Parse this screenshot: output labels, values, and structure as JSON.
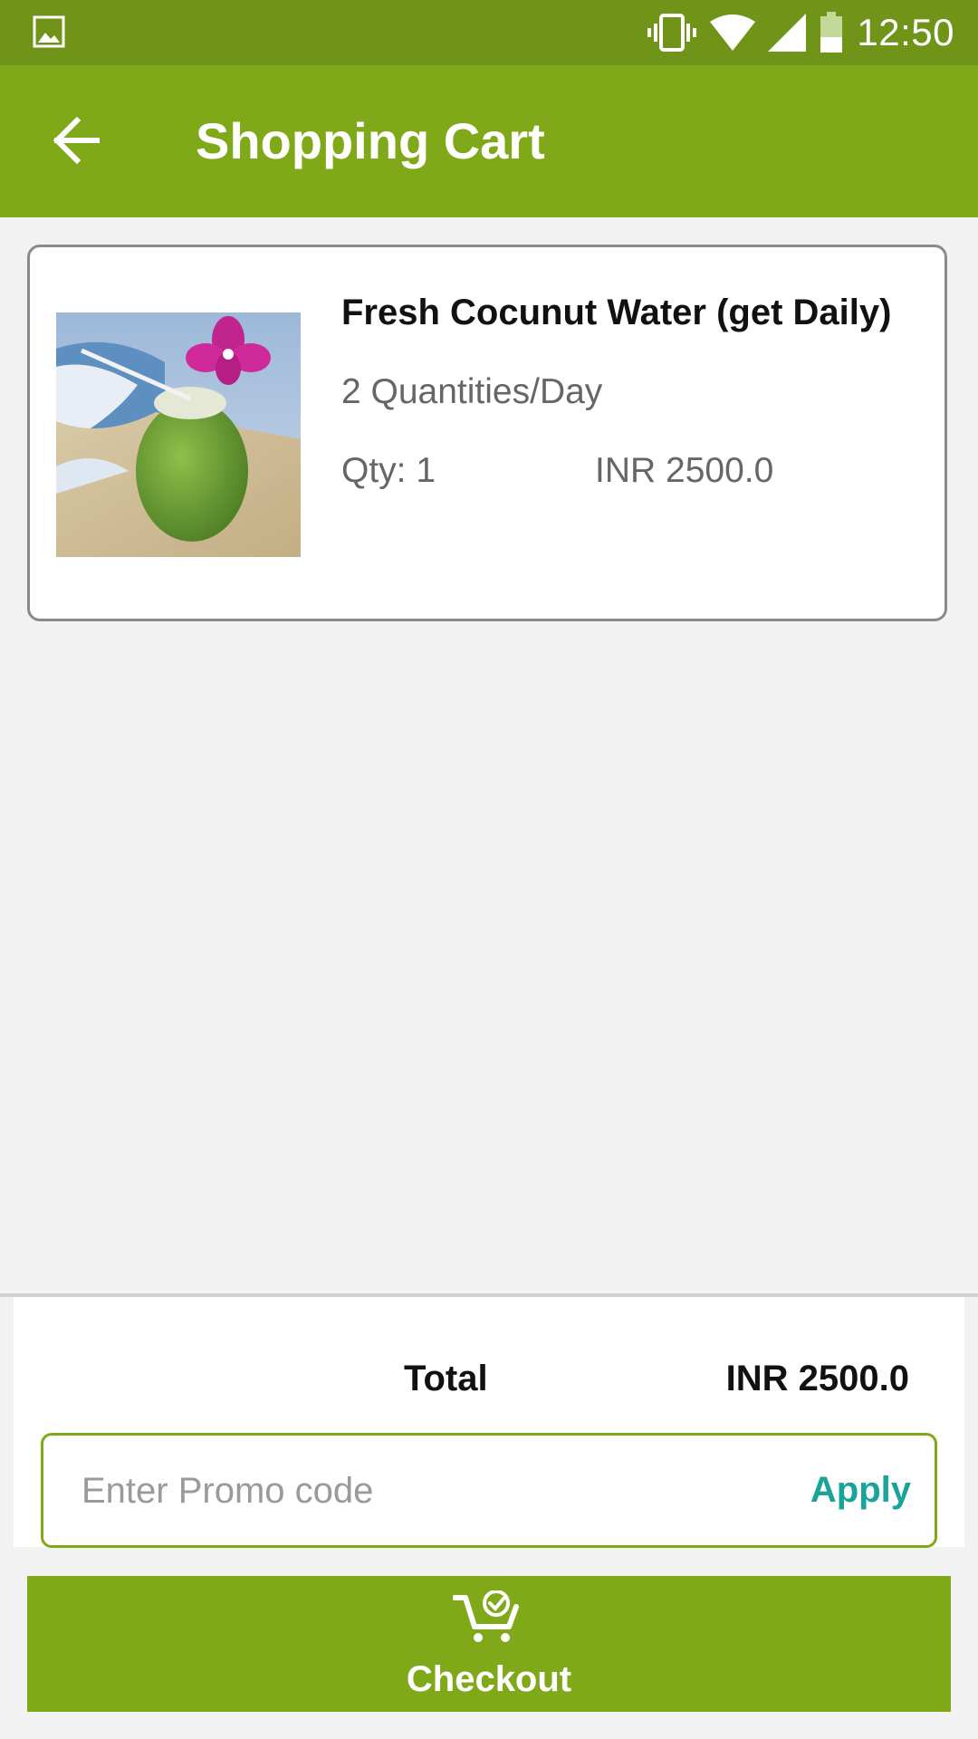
{
  "status_bar": {
    "time": "12:50",
    "icons": [
      "gallery-icon",
      "vibrate-icon",
      "wifi-icon",
      "signal-icon",
      "battery-icon"
    ]
  },
  "app_bar": {
    "title": "Shopping Cart",
    "back_icon": "arrow-back-icon",
    "color": "#80a91a"
  },
  "cart": {
    "items": [
      {
        "name": "Fresh Cocunut Water (get Daily)",
        "subtitle": "2 Quantities/Day",
        "qty": "Qty: 1",
        "price": "INR 2500.0",
        "image": "coconut-drink-photo"
      }
    ]
  },
  "summary": {
    "total_label": "Total",
    "total_value": "INR 2500.0"
  },
  "promo": {
    "placeholder": "Enter Promo code",
    "value": "",
    "apply_label": "Apply",
    "apply_color": "#1aa39a"
  },
  "checkout": {
    "label": "Checkout",
    "icon": "cart-check-icon"
  },
  "colors": {
    "status_bar": "#6f9418",
    "primary": "#80a91a",
    "background": "#f2f2f2"
  }
}
